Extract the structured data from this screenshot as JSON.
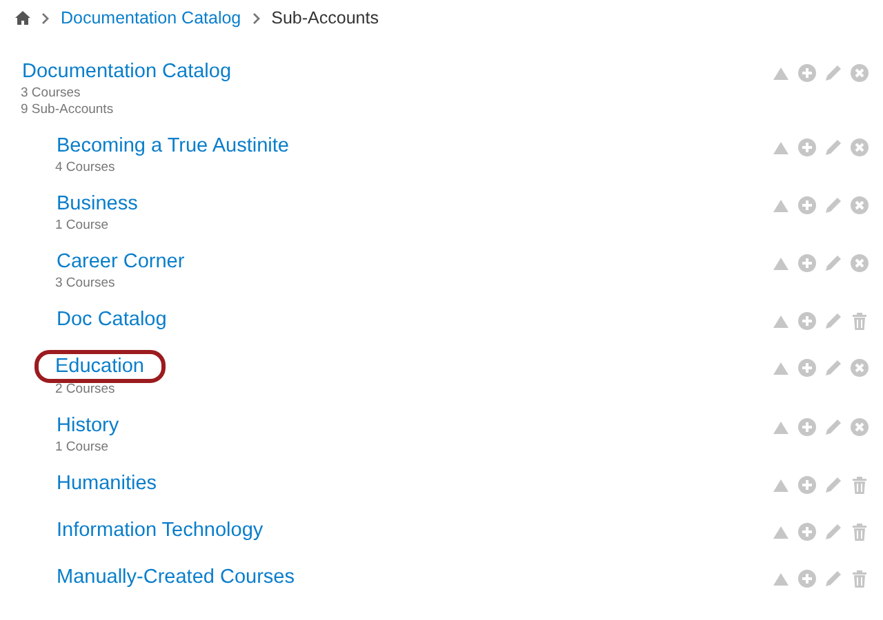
{
  "breadcrumb": {
    "items": [
      {
        "label": "Documentation Catalog",
        "kind": "link"
      },
      {
        "label": "Sub-Accounts",
        "kind": "current"
      }
    ]
  },
  "root": {
    "name": "Documentation Catalog",
    "details": [
      "3 Courses",
      "9 Sub-Accounts"
    ],
    "kind": "x"
  },
  "sub_accounts": [
    {
      "name": "Becoming a True Austinite",
      "details": [
        "4 Courses"
      ],
      "kind": "x",
      "highlighted": false
    },
    {
      "name": "Business",
      "details": [
        "1 Course"
      ],
      "kind": "x",
      "highlighted": false
    },
    {
      "name": "Career Corner",
      "details": [
        "3 Courses"
      ],
      "kind": "x",
      "highlighted": false
    },
    {
      "name": "Doc Catalog",
      "kind": "trash",
      "highlighted": false
    },
    {
      "name": "Education",
      "details": [
        "2 Courses"
      ],
      "kind": "x",
      "highlighted": true
    },
    {
      "name": "History",
      "details": [
        "1 Course"
      ],
      "kind": "x",
      "highlighted": false
    },
    {
      "name": "Humanities",
      "kind": "trash",
      "highlighted": false
    },
    {
      "name": "Information Technology",
      "kind": "trash",
      "highlighted": false
    },
    {
      "name": "Manually-Created Courses",
      "kind": "trash",
      "highlighted": false
    }
  ]
}
